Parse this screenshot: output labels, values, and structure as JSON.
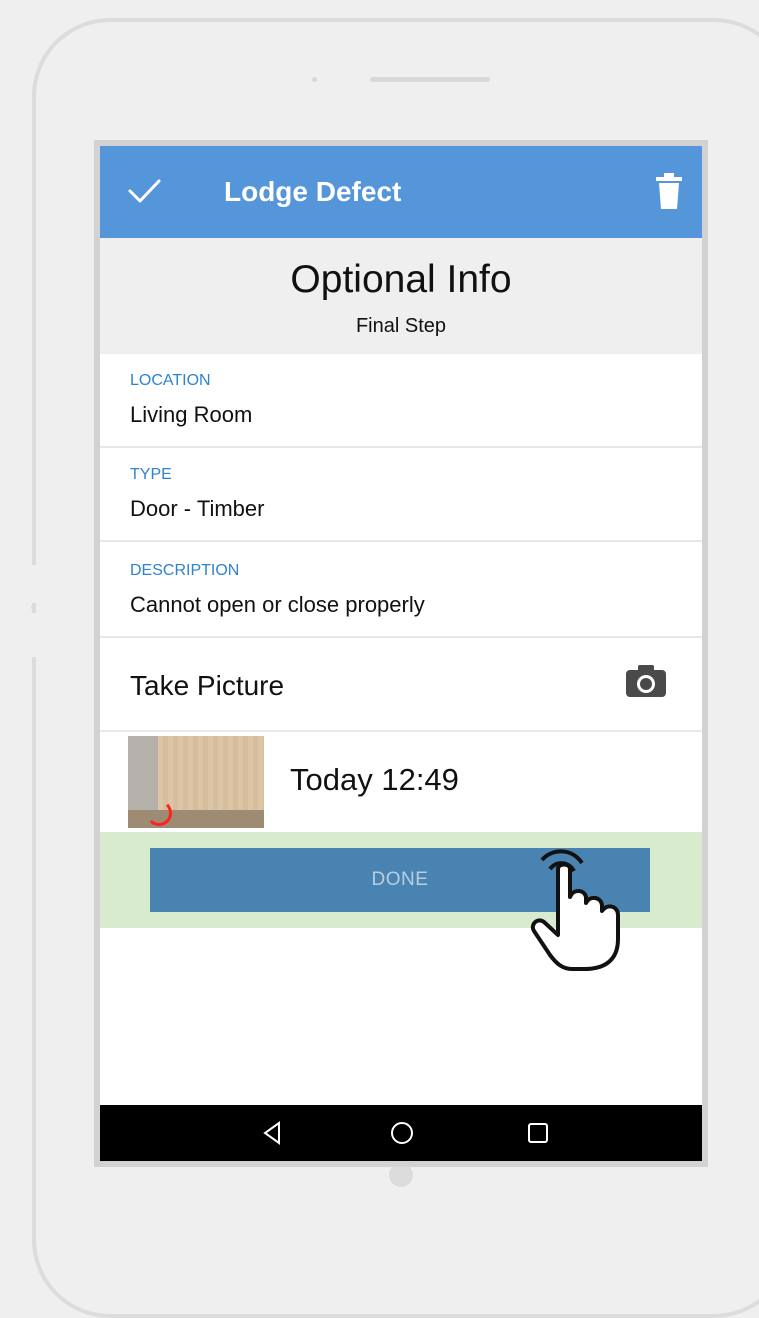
{
  "appbar": {
    "title": "Lodge Defect",
    "accent_color": "#5595d9",
    "check_icon": "checkmark-icon",
    "trash_icon": "trash-icon"
  },
  "header": {
    "title": "Optional Info",
    "subtitle": "Final Step"
  },
  "fields": [
    {
      "label": "LOCATION",
      "value": "Living Room"
    },
    {
      "label": "TYPE",
      "value": "Door - Timber"
    },
    {
      "label": "DESCRIPTION",
      "value": "Cannot open or close properly"
    }
  ],
  "take_picture": {
    "label": "Take Picture",
    "icon": "camera-icon"
  },
  "photo": {
    "timestamp": "Today 12:49"
  },
  "done": {
    "label": "DONE",
    "bar_color": "#d9ebcf",
    "button_color": "#4883b1"
  },
  "navbar": {
    "back_icon": "back-icon",
    "home_icon": "home-icon",
    "recents_icon": "recents-icon"
  }
}
